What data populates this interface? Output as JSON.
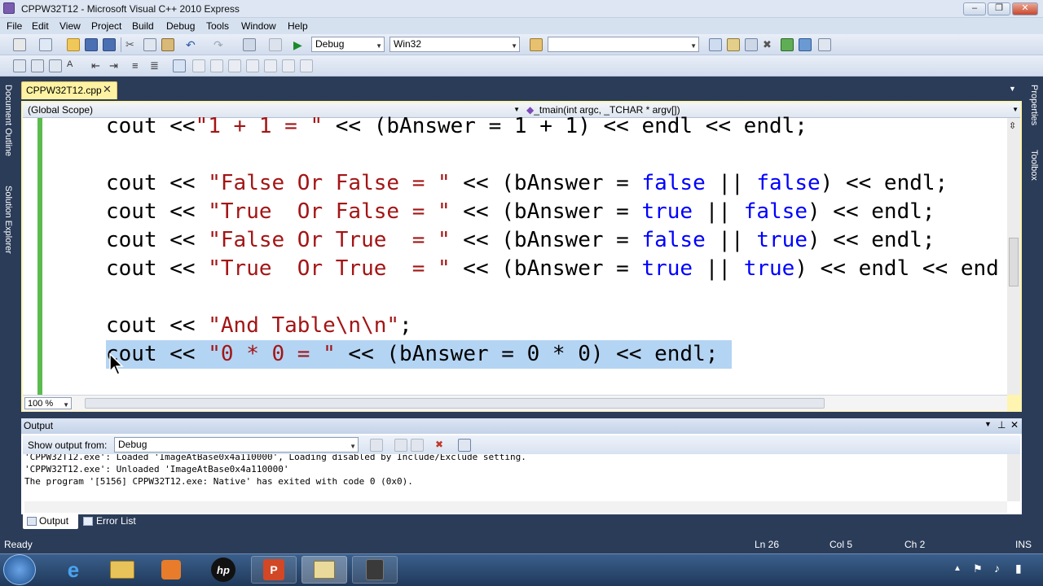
{
  "window": {
    "title": "CPPW32T12 - Microsoft Visual C++ 2010 Express",
    "min": "‒",
    "max": "❐",
    "close": "✕"
  },
  "menu": [
    "File",
    "Edit",
    "View",
    "Project",
    "Build",
    "Debug",
    "Tools",
    "Window",
    "Help"
  ],
  "toolbar": {
    "config": "Debug",
    "platform": "Win32",
    "find": ""
  },
  "doc_tab": {
    "label": "CPPW32T12.cpp",
    "close": "✕"
  },
  "scope": {
    "left": "(Global Scope)",
    "right": "_tmain(int argc, _TCHAR * argv[])"
  },
  "code_lines": [
    {
      "parts": [
        [
          "cout <<",
          ""
        ],
        [
          "\"1 + 1 = \"",
          "str"
        ],
        [
          " << (bAnswer = 1 + 1) << endl << endl;",
          ""
        ]
      ]
    },
    {
      "parts": [
        [
          "",
          ""
        ]
      ]
    },
    {
      "parts": [
        [
          "cout << ",
          ""
        ],
        [
          "\"False Or False = \"",
          "str"
        ],
        [
          " << (bAnswer = ",
          ""
        ],
        [
          "false",
          "kw"
        ],
        [
          " || ",
          ""
        ],
        [
          "false",
          "kw"
        ],
        [
          ") << endl;",
          ""
        ]
      ]
    },
    {
      "parts": [
        [
          "cout << ",
          ""
        ],
        [
          "\"True  Or False = \"",
          "str"
        ],
        [
          " << (bAnswer = ",
          ""
        ],
        [
          "true",
          "kw"
        ],
        [
          " || ",
          ""
        ],
        [
          "false",
          "kw"
        ],
        [
          ") << endl;",
          ""
        ]
      ]
    },
    {
      "parts": [
        [
          "cout << ",
          ""
        ],
        [
          "\"False Or True  = \"",
          "str"
        ],
        [
          " << (bAnswer = ",
          ""
        ],
        [
          "false",
          "kw"
        ],
        [
          " || ",
          ""
        ],
        [
          "true",
          "kw"
        ],
        [
          ") << endl;",
          ""
        ]
      ]
    },
    {
      "parts": [
        [
          "cout << ",
          ""
        ],
        [
          "\"True  Or True  = \"",
          "str"
        ],
        [
          " << (bAnswer = ",
          ""
        ],
        [
          "true",
          "kw"
        ],
        [
          " || ",
          ""
        ],
        [
          "true",
          "kw"
        ],
        [
          ") << endl << end",
          ""
        ]
      ]
    },
    {
      "parts": [
        [
          "",
          ""
        ]
      ]
    },
    {
      "parts": [
        [
          "cout << ",
          ""
        ],
        [
          "\"And Table\\n\\n\"",
          "str"
        ],
        [
          ";",
          ""
        ]
      ]
    },
    {
      "parts": [
        [
          "cout << ",
          ""
        ],
        [
          "\"0 * 0 = \"",
          "str"
        ],
        [
          " << (bAnswer = 0 * 0) << endl;",
          ""
        ]
      ]
    }
  ],
  "zoom": "100 %",
  "output": {
    "title": "Output",
    "show_from_label": "Show output from:",
    "source": "Debug",
    "lines": [
      "'CPPW32T12.exe': Loaded 'ImageAtBase0x4a110000', Loading disabled by Include/Exclude setting.",
      "'CPPW32T12.exe': Unloaded 'ImageAtBase0x4a110000'",
      "The program '[5156] CPPW32T12.exe: Native' has exited with code 0 (0x0)."
    ]
  },
  "bottom_tabs": [
    "Output",
    "Error List"
  ],
  "status": {
    "ready": "Ready",
    "ln": "Ln 26",
    "col": "Col 5",
    "ch": "Ch 2",
    "ins": "INS"
  },
  "left_dock": [
    "Document Outline",
    "Solution Explorer"
  ],
  "right_dock": [
    "Properties",
    "Toolbox"
  ],
  "taskbar": [
    "start",
    "ie",
    "explorer",
    "media",
    "hp",
    "powerpoint",
    "vs",
    "camtasia"
  ]
}
